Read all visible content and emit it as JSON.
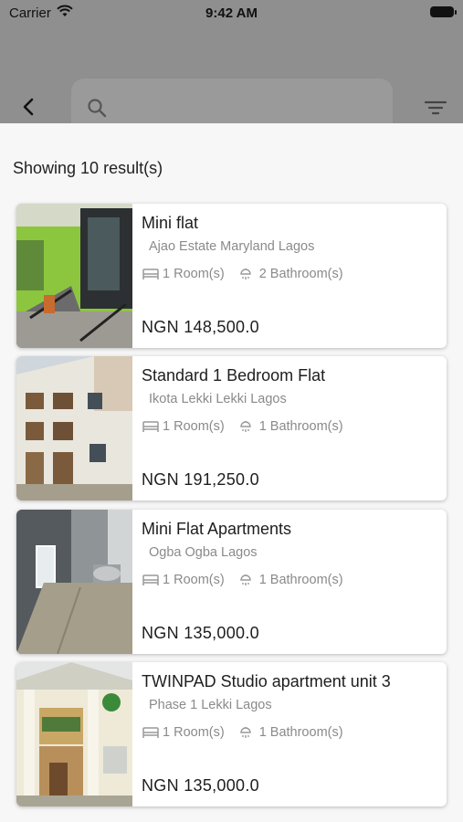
{
  "status_bar": {
    "carrier": "Carrier",
    "time": "9:42 AM"
  },
  "header": {
    "search_placeholder": "",
    "icons": [
      "back-arrow-icon",
      "search-icon",
      "filter-icon"
    ]
  },
  "results": {
    "summary": "Showing 10 result(s)"
  },
  "listings": [
    {
      "title": "Mini flat",
      "location": "Ajao Estate Maryland Lagos",
      "rooms": "1 Room(s)",
      "bathrooms": "2 Bathroom(s)",
      "price": "NGN 148,500.0"
    },
    {
      "title": "Standard 1 Bedroom Flat",
      "location": "Ikota Lekki  Lekki Lagos",
      "rooms": "1 Room(s)",
      "bathrooms": "1 Bathroom(s)",
      "price": "NGN 191,250.0"
    },
    {
      "title": "Mini Flat Apartments",
      "location": "Ogba Ogba Lagos",
      "rooms": "1 Room(s)",
      "bathrooms": "1 Bathroom(s)",
      "price": "NGN 135,000.0"
    },
    {
      "title": "TWINPAD Studio apartment unit 3",
      "location": "Phase 1 Lekki  Lagos",
      "rooms": "1 Room(s)",
      "bathrooms": "1 Bathroom(s)",
      "price": "NGN 135,000.0"
    }
  ],
  "colors": {
    "header_overlay": "#8f8f8f",
    "sheet_background": "#f7f7f7",
    "card_background": "#ffffff",
    "secondary_text": "#8a8a8a"
  }
}
